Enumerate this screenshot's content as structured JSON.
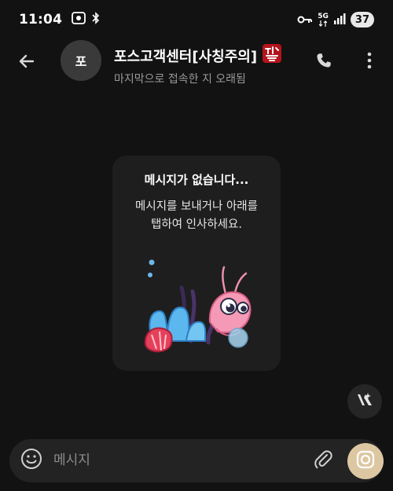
{
  "status_bar": {
    "time": "11:04",
    "network": "5G",
    "battery": "37",
    "icons": [
      "screen-record-icon",
      "bluetooth-icon",
      "vpn-key-icon",
      "network-5g-icon",
      "signal-icon",
      "battery-icon"
    ]
  },
  "header": {
    "avatar_initial": "포",
    "title": "포스고객센터[사칭주의]",
    "warning_sticker_label": "사칭주의",
    "subtitle": "마지막으로 접속한 지 오래됨",
    "icons": [
      "back-arrow-icon",
      "phone-icon",
      "more-vertical-icon"
    ]
  },
  "empty_state": {
    "title": "메시지가 없습니다...",
    "line1": "메시지를 보내거나 아래를",
    "line2": "탭하여 인사하세요.",
    "sticker": "shrimp-sticker"
  },
  "composer": {
    "placeholder": "메시지",
    "icons": [
      "emoji-icon",
      "attachment-icon",
      "camera-icon"
    ]
  },
  "fab": {
    "icon": "ai-sparkle-icon"
  },
  "colors": {
    "background": "#121212",
    "card": "#1e1e1e",
    "composer": "#232323",
    "camera_button": "#ddc7a2",
    "subtitle_text": "#9a9a9a"
  }
}
